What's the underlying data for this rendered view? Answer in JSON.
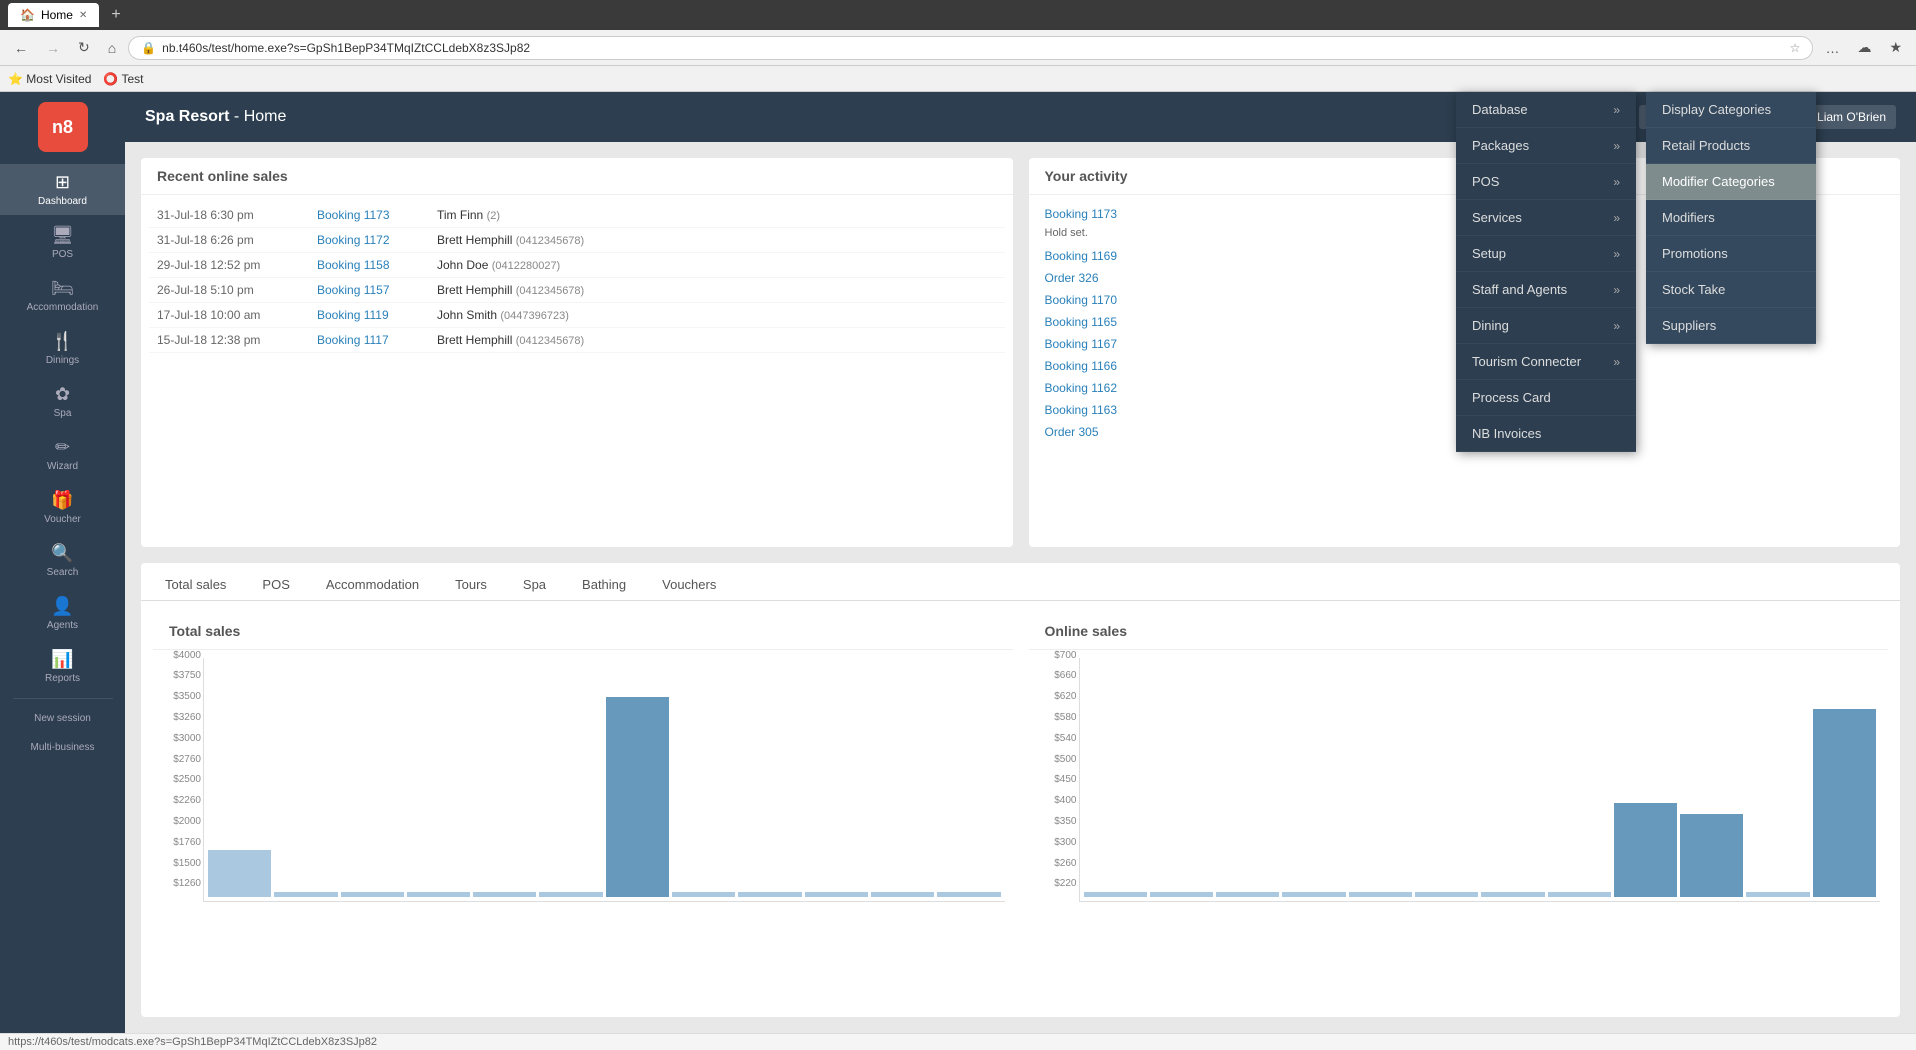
{
  "browser": {
    "tab_title": "Home",
    "new_tab_label": "+",
    "address": "nb.t460s/test/home.exe?s=GpSh1BepP34TMqIZtCCLdebX8z3SJp82",
    "back_btn": "←",
    "forward_btn": "→",
    "reload_btn": "↻",
    "home_btn": "⌂",
    "bookmarks": [
      "Most Visited",
      "Test"
    ],
    "nav_icons": [
      "…",
      "☁",
      "★"
    ]
  },
  "topbar": {
    "app_title": "Spa Resort",
    "page": "Home",
    "settings_label": "⚙",
    "user_label": "👤",
    "help_label": "?",
    "username": "Liam O'Brien"
  },
  "sidebar": {
    "logo_text": "n8",
    "items": [
      {
        "id": "dashboard",
        "icon": "⊞",
        "label": "Dashboard",
        "active": true
      },
      {
        "id": "pos",
        "icon": "🖥",
        "label": "POS"
      },
      {
        "id": "accommodation",
        "icon": "🛏",
        "label": "Accommodation"
      },
      {
        "id": "dinings",
        "icon": "🍴",
        "label": "Dinings"
      },
      {
        "id": "spa",
        "icon": "✿",
        "label": "Spa"
      },
      {
        "id": "wizard",
        "icon": "✏",
        "label": "Wizard"
      },
      {
        "id": "voucher",
        "icon": "🎁",
        "label": "Voucher"
      },
      {
        "id": "search",
        "icon": "🔍",
        "label": "Search"
      },
      {
        "id": "agents",
        "icon": "👤",
        "label": "Agents"
      },
      {
        "id": "reports",
        "icon": "📊",
        "label": "Reports"
      },
      {
        "id": "new-session",
        "icon": "",
        "label": "New session"
      },
      {
        "id": "multi-business",
        "icon": "",
        "label": "Multi-business"
      }
    ]
  },
  "content": {
    "recent_sales": {
      "title": "Recent online sales",
      "rows": [
        {
          "date": "31-Jul-18 6:30 pm",
          "booking": "Booking 1173",
          "customer": "Tim Finn",
          "phone": "(2)"
        },
        {
          "date": "31-Jul-18 6:26 pm",
          "booking": "Booking 1172",
          "customer": "Brett Hemphill",
          "phone": "(0412345678)"
        },
        {
          "date": "29-Jul-18 12:52 pm",
          "booking": "Booking 1158",
          "customer": "John Doe",
          "phone": "(0412280027)"
        },
        {
          "date": "26-Jul-18 5:10 pm",
          "booking": "Booking 1157",
          "customer": "Brett Hemphill",
          "phone": "(0412345678)"
        },
        {
          "date": "17-Jul-18 10:00 am",
          "booking": "Booking 1119",
          "customer": "John Smith",
          "phone": "(0447396723)"
        },
        {
          "date": "15-Jul-18 12:38 pm",
          "booking": "Booking 1117",
          "customer": "Brett Hemphill",
          "phone": "(0412345678)"
        }
      ]
    },
    "activity": {
      "title": "Your activity",
      "items": [
        {
          "label": "Booking 1173",
          "sub": ""
        },
        {
          "label": "Hold set.",
          "sub": "",
          "is_sub": true
        },
        {
          "label": "Booking 1169",
          "sub": ""
        },
        {
          "label": "Order 326",
          "sub": ""
        },
        {
          "label": "Booking 1170",
          "sub": ""
        },
        {
          "label": "Booking 1165",
          "sub": ""
        },
        {
          "label": "Booking 1167",
          "sub": ""
        },
        {
          "label": "Booking 1166",
          "sub": ""
        },
        {
          "label": "Booking 1162",
          "sub": ""
        },
        {
          "label": "Booking 1163",
          "sub": ""
        },
        {
          "label": "Order 305",
          "sub": ""
        }
      ]
    },
    "tabs": [
      "Total sales",
      "POS",
      "Accommodation",
      "Tours",
      "Spa",
      "Bathing",
      "Vouchers"
    ],
    "total_sales": {
      "title": "Total sales",
      "y_labels": [
        "$4000",
        "$3750",
        "$3500",
        "$3260",
        "$3000",
        "$2760",
        "$2500",
        "$2260",
        "$2000",
        "$1760",
        "$1500",
        "$1260"
      ],
      "bars": [
        20,
        0,
        0,
        0,
        0,
        0,
        85,
        0,
        0,
        0,
        0,
        0
      ]
    },
    "online_sales": {
      "title": "Online sales",
      "y_labels": [
        "$700",
        "$660",
        "$620",
        "$580",
        "$540",
        "$500",
        "$450",
        "$400",
        "$350",
        "$300",
        "$260",
        "$220"
      ],
      "bars": [
        0,
        0,
        0,
        0,
        0,
        0,
        0,
        0,
        40,
        35,
        0,
        80
      ]
    }
  },
  "dropdown": {
    "items": [
      {
        "label": "Database",
        "has_sub": true
      },
      {
        "label": "Packages",
        "has_sub": true
      },
      {
        "label": "POS",
        "has_sub": true
      },
      {
        "label": "Services",
        "has_sub": true
      },
      {
        "label": "Setup",
        "has_sub": true
      },
      {
        "label": "Staff and Agents",
        "has_sub": true
      },
      {
        "label": "Dining",
        "has_sub": true
      },
      {
        "label": "Tourism Connecter",
        "has_sub": true
      },
      {
        "label": "Process Card",
        "has_sub": false
      },
      {
        "label": "NB Invoices",
        "has_sub": false
      }
    ]
  },
  "submenu": {
    "items": [
      {
        "label": "Display Categories",
        "active": false
      },
      {
        "label": "Retail Products",
        "active": false
      },
      {
        "label": "Modifier Categories",
        "active": true
      },
      {
        "label": "Modifiers",
        "active": false
      },
      {
        "label": "Promotions",
        "active": false
      },
      {
        "label": "Stock Take",
        "active": false
      },
      {
        "label": "Suppliers",
        "active": false
      }
    ]
  },
  "statusbar": {
    "text": "https://t460s/test/modcats.exe?s=GpSh1BepP34TMqIZtCCLdebX8z3SJp82"
  }
}
